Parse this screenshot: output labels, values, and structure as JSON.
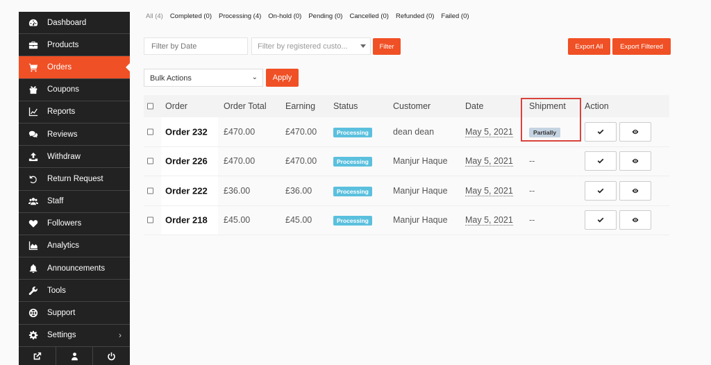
{
  "sidebar": {
    "items": [
      {
        "label": "Dashboard",
        "icon": "dashboard-icon"
      },
      {
        "label": "Products",
        "icon": "briefcase-icon"
      },
      {
        "label": "Orders",
        "icon": "cart-icon",
        "active": true
      },
      {
        "label": "Coupons",
        "icon": "gift-icon"
      },
      {
        "label": "Reports",
        "icon": "line-chart-icon"
      },
      {
        "label": "Reviews",
        "icon": "comments-icon"
      },
      {
        "label": "Withdraw",
        "icon": "upload-icon"
      },
      {
        "label": "Return Request",
        "icon": "undo-icon"
      },
      {
        "label": "Staff",
        "icon": "users-icon"
      },
      {
        "label": "Followers",
        "icon": "heart-icon"
      },
      {
        "label": "Analytics",
        "icon": "area-chart-icon"
      },
      {
        "label": "Announcements",
        "icon": "bell-icon"
      },
      {
        "label": "Tools",
        "icon": "wrench-icon"
      },
      {
        "label": "Support",
        "icon": "lifebuoy-icon"
      },
      {
        "label": "Settings",
        "icon": "gear-icon"
      }
    ],
    "footer_icons": [
      "external-link-icon",
      "user-icon",
      "power-icon"
    ]
  },
  "status_filters": [
    {
      "label": "All (4)",
      "current": true
    },
    {
      "label": "Completed (0)"
    },
    {
      "label": "Processing (4)"
    },
    {
      "label": "On-hold (0)"
    },
    {
      "label": "Pending (0)"
    },
    {
      "label": "Cancelled (0)"
    },
    {
      "label": "Refunded (0)"
    },
    {
      "label": "Failed (0)"
    }
  ],
  "filters": {
    "date_placeholder": "Filter by Date",
    "customer_placeholder": "Filter by registered custo...",
    "filter_button": "Filter",
    "export_all": "Export All",
    "export_filtered": "Export Filtered",
    "bulk_actions": "Bulk Actions",
    "apply": "Apply"
  },
  "table": {
    "headers": {
      "order": "Order",
      "order_total": "Order Total",
      "earning": "Earning",
      "status": "Status",
      "customer": "Customer",
      "date": "Date",
      "shipment": "Shipment",
      "action": "Action"
    },
    "rows": [
      {
        "order": "Order 232",
        "total": "£470.00",
        "earning": "£470.00",
        "status": "Processing",
        "customer": "dean dean",
        "date": "May 5, 2021",
        "shipment": "Partially"
      },
      {
        "order": "Order 226",
        "total": "£470.00",
        "earning": "£470.00",
        "status": "Processing",
        "customer": "Manjur Haque",
        "date": "May 5, 2021",
        "shipment": "--"
      },
      {
        "order": "Order 222",
        "total": "£36.00",
        "earning": "£36.00",
        "status": "Processing",
        "customer": "Manjur Haque",
        "date": "May 5, 2021",
        "shipment": "--"
      },
      {
        "order": "Order 218",
        "total": "£45.00",
        "earning": "£45.00",
        "status": "Processing",
        "customer": "Manjur Haque",
        "date": "May 5, 2021",
        "shipment": "--"
      }
    ]
  },
  "colors": {
    "accent": "#f05025",
    "sidebar_bg": "#222222",
    "processing_badge": "#5bc0de",
    "partially_badge": "#c5d4e2",
    "highlight_border": "#d9433b"
  }
}
